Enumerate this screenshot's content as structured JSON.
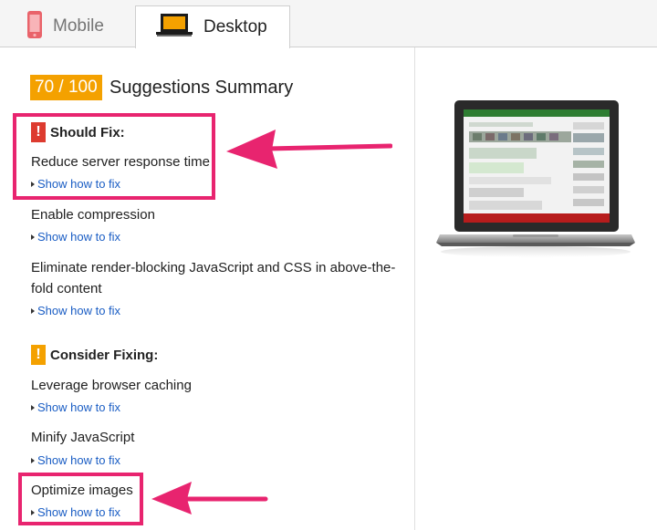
{
  "tabs": {
    "mobile": {
      "label": "Mobile",
      "icon": "phone-icon"
    },
    "desktop": {
      "label": "Desktop",
      "icon": "laptop-icon"
    }
  },
  "score": {
    "value": "70 / 100",
    "title": "Suggestions Summary",
    "color": "#f4a100"
  },
  "should_fix": {
    "header": "Should Fix:",
    "items": [
      {
        "title": "Reduce server response time",
        "link": "Show how to fix"
      },
      {
        "title": "Enable compression",
        "link": "Show how to fix"
      },
      {
        "title": "Eliminate render-blocking JavaScript and CSS in above-the-fold content",
        "link": "Show how to fix"
      }
    ]
  },
  "consider_fixing": {
    "header": "Consider Fixing:",
    "items": [
      {
        "title": "Leverage browser caching",
        "link": "Show how to fix"
      },
      {
        "title": "Minify JavaScript",
        "link": "Show how to fix"
      },
      {
        "title": "Optimize images",
        "link": "Show how to fix"
      }
    ]
  },
  "preview": {
    "icon": "laptop-preview-image"
  },
  "colors": {
    "highlight": "#e8246f",
    "link": "#1a5dc4",
    "error": "#dd3b2f",
    "warning": "#f4a100"
  }
}
